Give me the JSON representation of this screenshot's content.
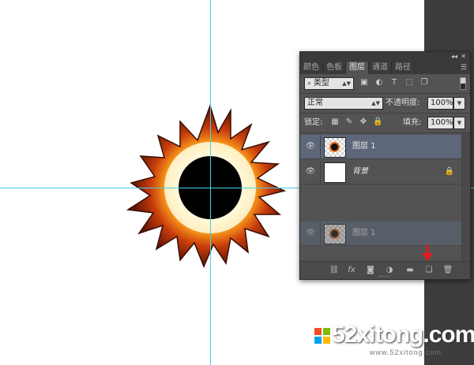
{
  "panel": {
    "tabs": [
      "颜色",
      "色板",
      "图层",
      "通道",
      "路径"
    ],
    "active_tab": "图层",
    "filter": {
      "kind_label": "类型"
    },
    "blend_mode": "正常",
    "opacity": {
      "label": "不透明度:",
      "value": "100%"
    },
    "lock": {
      "label": "锁定:"
    },
    "fill": {
      "label": "填充:",
      "value": "100%"
    },
    "layers": [
      {
        "name": "图层 1",
        "selected": true,
        "thumb": "transparent-with-sun"
      },
      {
        "name": "背景",
        "selected": false,
        "thumb": "white",
        "locked": true
      },
      {
        "name": "图层 1",
        "selected": false,
        "thumb": "transparent-with-sun",
        "ghost": true
      }
    ],
    "bottom_icons": [
      "link-icon",
      "fx-icon",
      "mask-icon",
      "adjustment-icon",
      "folder-icon",
      "new-layer-icon",
      "trash-icon"
    ],
    "fx_label": "fx"
  },
  "watermark": {
    "text": "52xitong.com",
    "sub": "www.52xitong.com"
  },
  "colors": {
    "panel_bg": "#535353",
    "selected_layer": "#5d6779",
    "guide": "#44d0e6",
    "arrow": "#e11b1b"
  }
}
